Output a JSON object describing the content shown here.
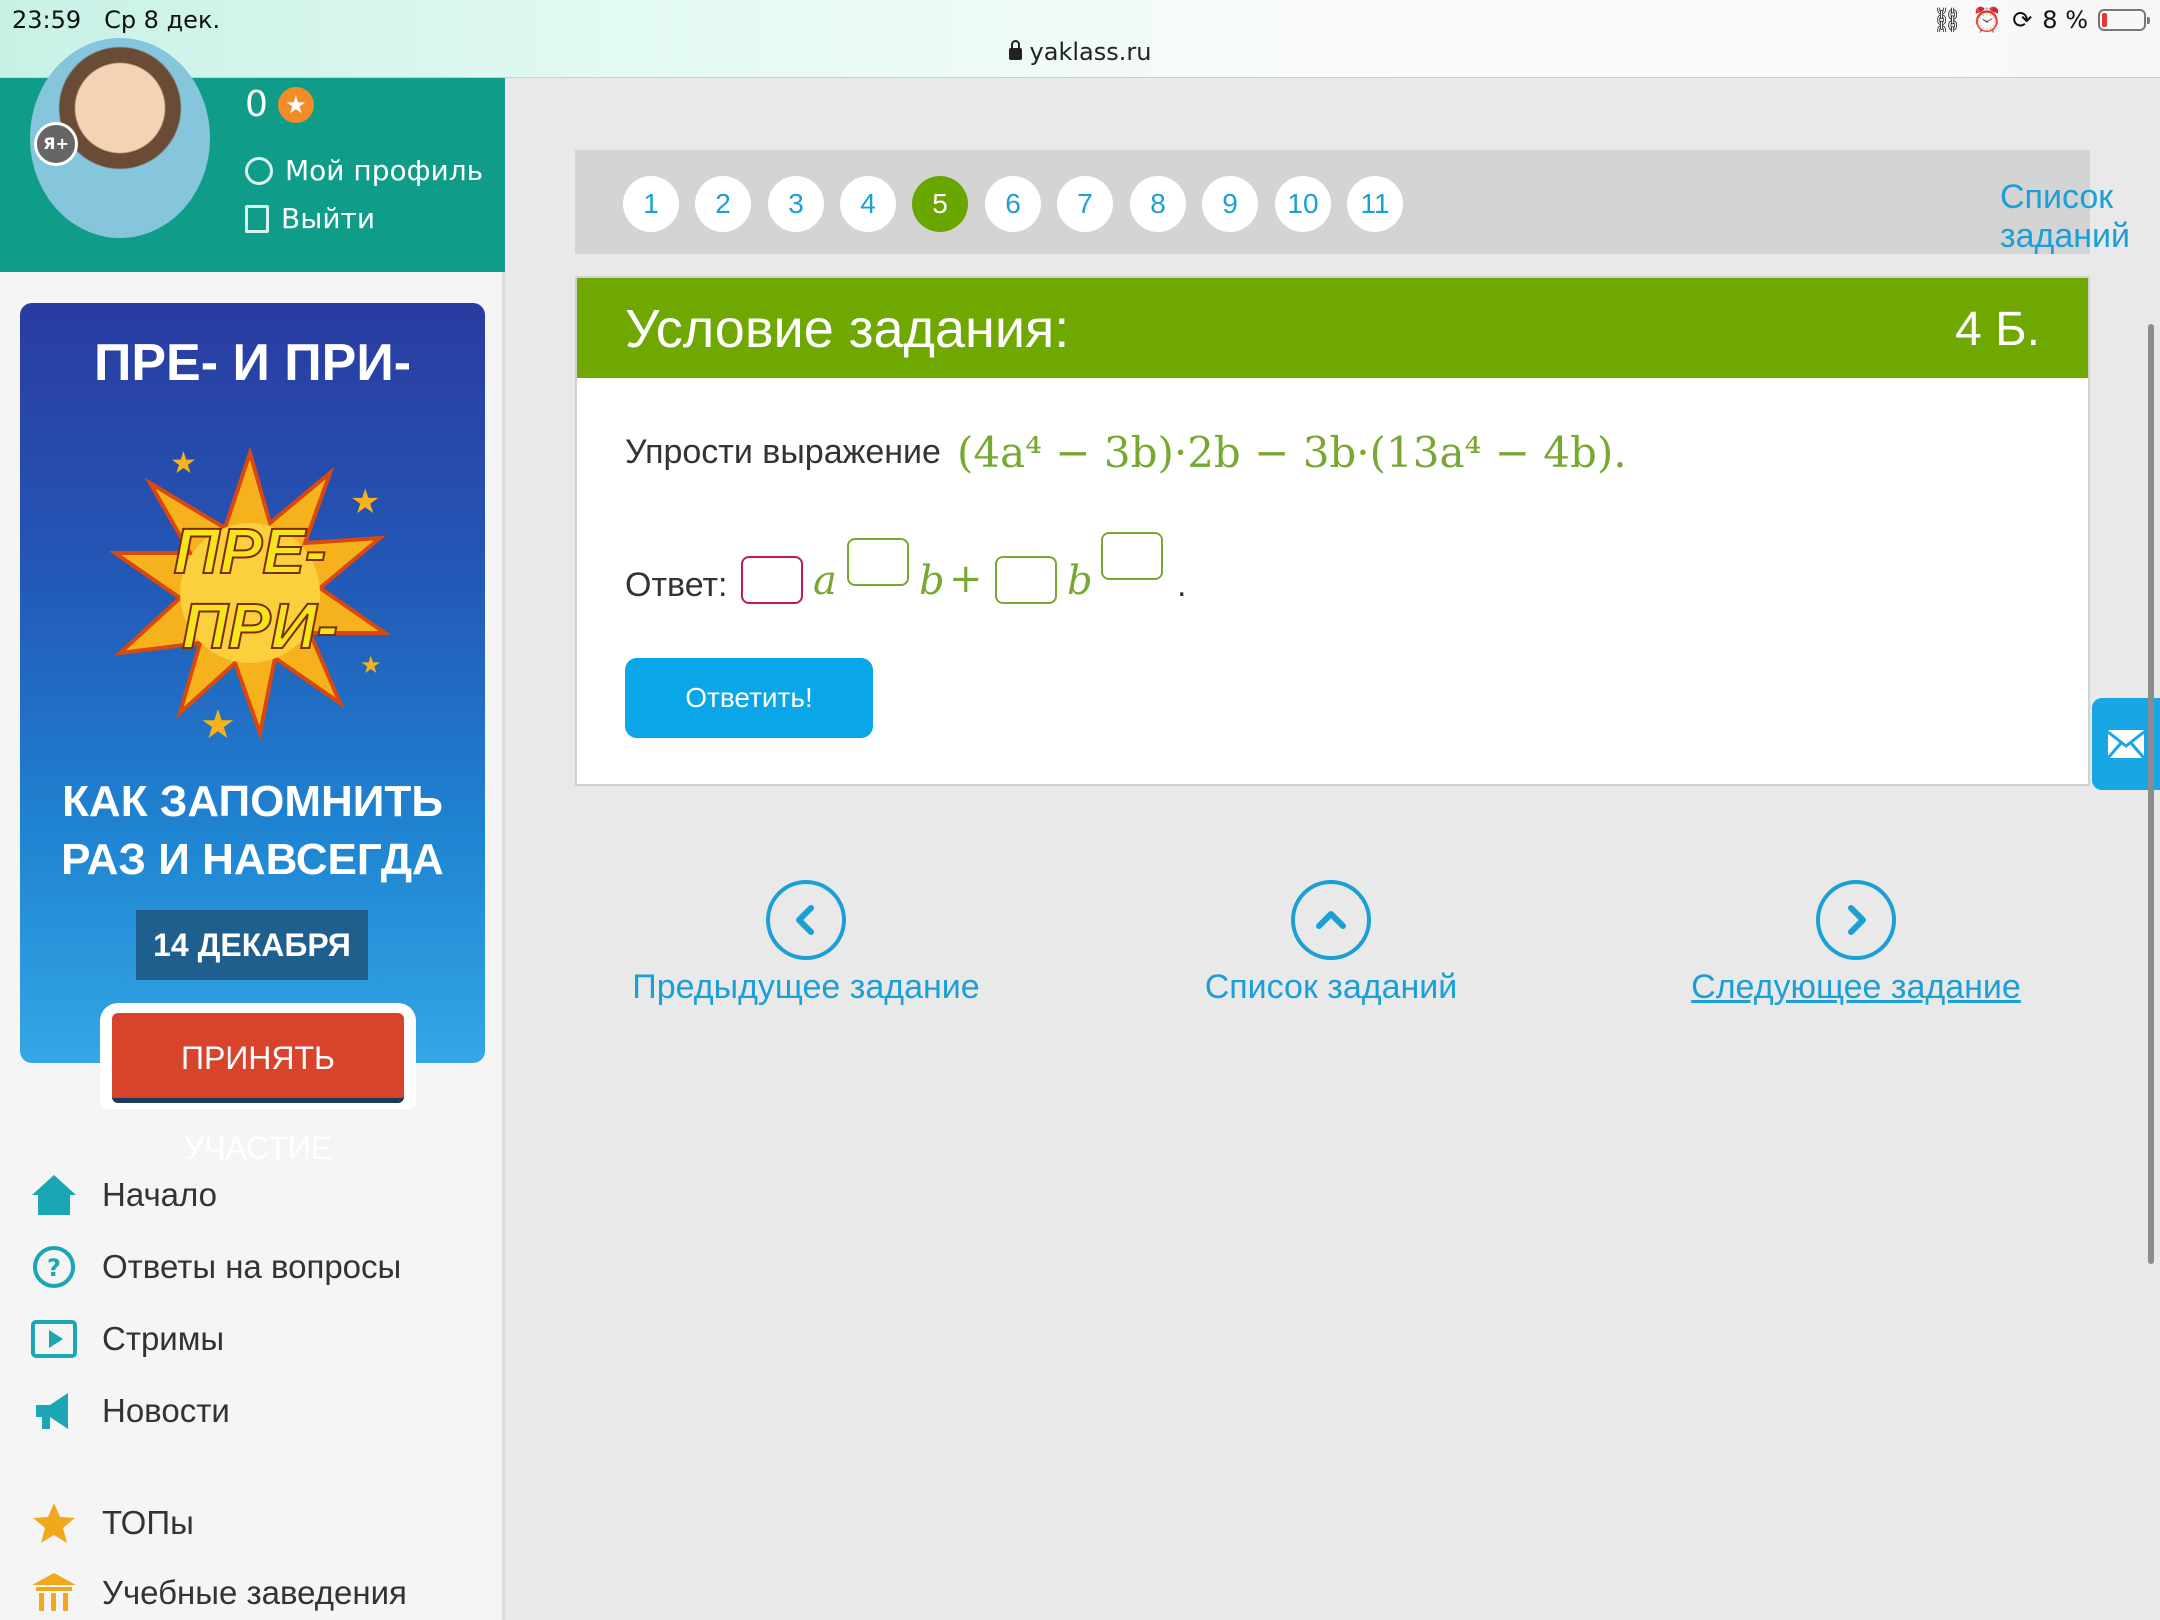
{
  "status": {
    "time": "23:59",
    "date": "Ср 8 дек.",
    "url": "yaklass.ru",
    "battery": "8 %"
  },
  "profile": {
    "score": "0",
    "badge": "Я+",
    "my_profile": "Мой профиль",
    "logout": "Выйти"
  },
  "banner": {
    "title": "ПРЕ- И ПРИ-",
    "burst_top": "ПРЕ-",
    "burst_bottom": "ПРИ-",
    "subtitle_line1": "КАК ЗАПОМНИТЬ",
    "subtitle_line2": "РАЗ И НАВСЕГДА",
    "date": "14 ДЕКАБРЯ",
    "cta": "ПРИНЯТЬ УЧАСТИЕ"
  },
  "nav": {
    "items": [
      {
        "label": "Начало",
        "icon": "home-icon"
      },
      {
        "label": "Ответы на вопросы",
        "icon": "question-icon"
      },
      {
        "label": "Стримы",
        "icon": "play-icon"
      },
      {
        "label": "Новости",
        "icon": "megaphone-icon"
      },
      {
        "label": "ТОПы",
        "icon": "star-icon"
      },
      {
        "label": "Учебные заведения",
        "icon": "building-icon"
      }
    ]
  },
  "pager": {
    "pages": [
      "1",
      "2",
      "3",
      "4",
      "5",
      "6",
      "7",
      "8",
      "9",
      "10",
      "11"
    ],
    "active": "5",
    "list_link": "Список заданий"
  },
  "task": {
    "title": "Условие задания:",
    "points": "4 Б.",
    "prompt": "Упрости выражение",
    "formula": "(4a⁴ − 3b)·2b − 3b·(13a⁴ − 4b).",
    "answer_label": "Ответ:",
    "var_a": "a",
    "var_b1": "b",
    "plus": "+",
    "var_b2": "b",
    "end_dot": ".",
    "submit": "Ответить!"
  },
  "bottom_nav": {
    "prev": "Предыдущее задание",
    "list": "Список заданий",
    "next": "Следующее задание"
  },
  "colors": {
    "accent_green": "#6ea800",
    "link_blue": "#1a9fd6",
    "teal": "#0f9d8a",
    "button_blue": "#0ba6e8"
  }
}
